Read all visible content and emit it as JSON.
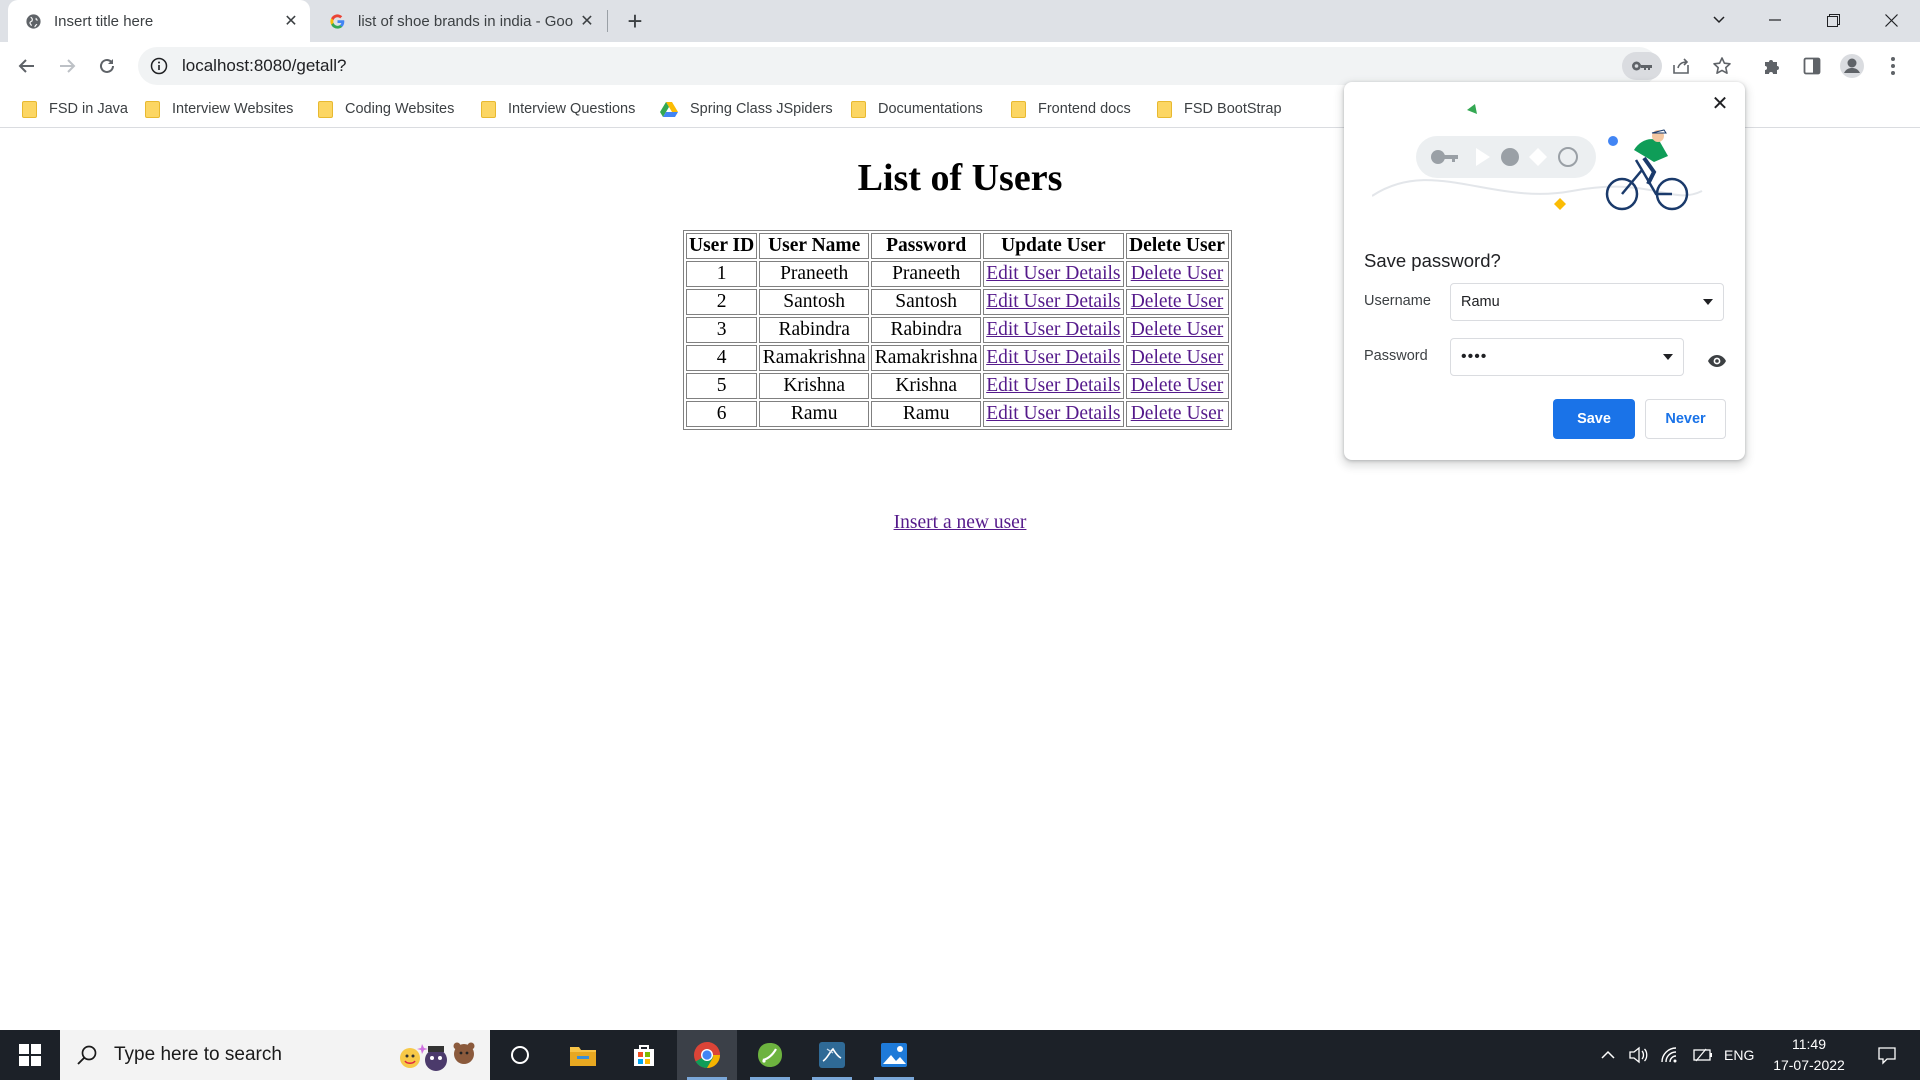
{
  "browser": {
    "tabs": [
      {
        "title": "Insert title here",
        "active": true
      },
      {
        "title": "list of shoe brands in india - Goo",
        "active": false
      }
    ],
    "url": "localhost:8080/getall?",
    "bookmarks": [
      {
        "label": "FSD in Java",
        "icon": "folder-icon"
      },
      {
        "label": "Interview Websites",
        "icon": "folder-icon"
      },
      {
        "label": "Coding Websites",
        "icon": "folder-icon"
      },
      {
        "label": "Interview Questions",
        "icon": "folder-icon"
      },
      {
        "label": "Spring Class JSpiders",
        "icon": "google-drive-icon"
      },
      {
        "label": "Documentations",
        "icon": "folder-icon"
      },
      {
        "label": "Frontend docs",
        "icon": "folder-icon"
      },
      {
        "label": "FSD BootStrap",
        "icon": "folder-icon"
      }
    ]
  },
  "page": {
    "title": "List of Users",
    "table": {
      "headers": [
        "User ID",
        "User Name",
        "Password",
        "Update User",
        "Delete User"
      ],
      "rows": [
        {
          "id": "1",
          "name": "Praneeth",
          "password": "Praneeth",
          "update": "Edit User Details",
          "delete": "Delete User"
        },
        {
          "id": "2",
          "name": "Santosh",
          "password": "Santosh",
          "update": "Edit User Details",
          "delete": "Delete User"
        },
        {
          "id": "3",
          "name": "Rabindra",
          "password": "Rabindra",
          "update": "Edit User Details",
          "delete": "Delete User"
        },
        {
          "id": "4",
          "name": "Ramakrishna",
          "password": "Ramakrishna",
          "update": "Edit User Details",
          "delete": "Delete User"
        },
        {
          "id": "5",
          "name": "Krishna",
          "password": "Krishna",
          "update": "Edit User Details",
          "delete": "Delete User"
        },
        {
          "id": "6",
          "name": "Ramu",
          "password": "Ramu",
          "update": "Edit User Details",
          "delete": "Delete User"
        }
      ]
    },
    "insert_link": "Insert a new user"
  },
  "save_password_popup": {
    "title": "Save password?",
    "username_label": "Username",
    "username_value": "Ramu",
    "password_label": "Password",
    "password_value": "••••",
    "save_label": "Save",
    "never_label": "Never"
  },
  "taskbar": {
    "search_placeholder": "Type here to search",
    "language": "ENG",
    "time": "11:49",
    "date": "17-07-2022"
  },
  "colors": {
    "link_visited": "#551a8b",
    "primary_button": "#1a73e8",
    "taskbar": "#1c2128",
    "tabstrip": "#dee1e6"
  }
}
